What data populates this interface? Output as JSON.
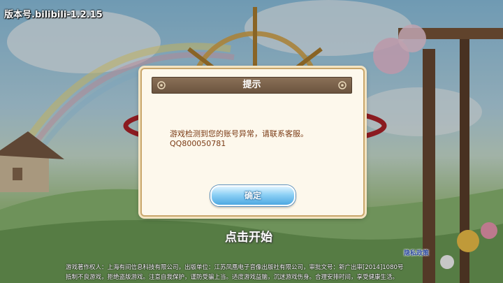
{
  "app": {
    "version_label": "版本号.bilibili-1.2.15",
    "start_label": "点击开始",
    "privacy_link": "隐私政策"
  },
  "dialog": {
    "title": "提示",
    "message_line1": "游戏检测到您的账号异常，请联系客服。",
    "message_line2": "QQ800050781",
    "confirm_label": "确定"
  },
  "footer": {
    "line1": "游戏著作权人：上海有间信息科技有限公司，出版单位：江苏凤凰电子音像出版社有限公司，审批文号：新广出审[2014]1080号",
    "line2": "抵制不良游戏，拒绝盗版游戏。注意自我保护，谨防受骗上当。适度游戏益脑，沉迷游戏伤身。合理安排时间，享受健康生活。"
  },
  "colors": {
    "dialog_bg": "#fdf8ec",
    "title_bar": "#6b543f",
    "message_text": "#7a3a14",
    "button_blue": "#4ea8e2",
    "privacy_link": "#2d4a9c"
  }
}
